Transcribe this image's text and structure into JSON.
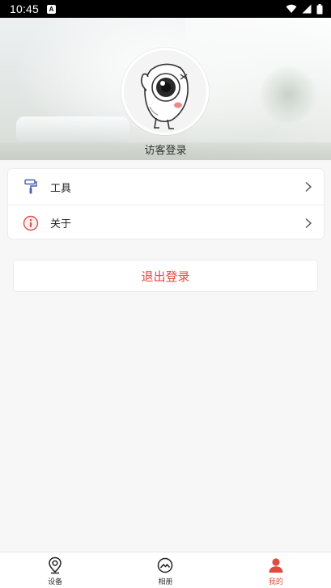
{
  "status_bar": {
    "time": "10:45",
    "notification_badge": "A",
    "icons": [
      "wifi-icon",
      "signal-icon",
      "battery-icon"
    ]
  },
  "profile": {
    "login_label": "访客登录",
    "avatar_icon": "cartoon-eyeball-avatar"
  },
  "menu": {
    "items": [
      {
        "label": "工具",
        "icon": "paint-roller-icon"
      },
      {
        "label": "关于",
        "icon": "info-circle-icon"
      }
    ]
  },
  "logout": {
    "label": "退出登录"
  },
  "bottom_nav": {
    "tabs": [
      {
        "label": "设备",
        "icon": "location-pin-icon",
        "active": false
      },
      {
        "label": "相册",
        "icon": "mountain-circle-icon",
        "active": false
      },
      {
        "label": "我的",
        "icon": "person-icon",
        "active": true
      }
    ]
  },
  "colors": {
    "accent": "#e14a3c",
    "background": "#f7f7f7",
    "text": "#222222"
  }
}
